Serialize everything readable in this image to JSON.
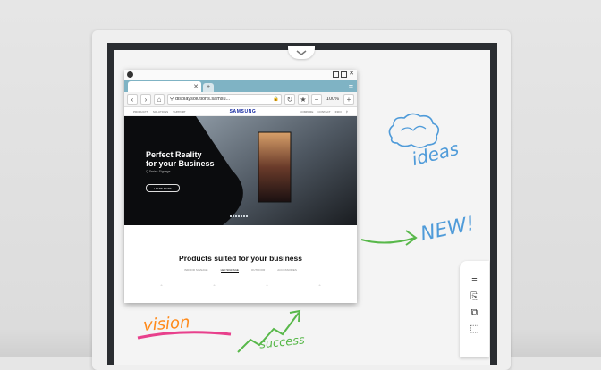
{
  "browser": {
    "url": "displaysolutions.samsu...",
    "zoom": "100%",
    "site_logo": "SAMSUNG",
    "nav_left": [
      "PRODUCTS",
      "SOLUTIONS",
      "SUPPORT"
    ],
    "nav_right": [
      "COMPARE",
      "CONTACT",
      "INFO"
    ],
    "hero_title_line1": "Perfect Reality",
    "hero_title_line2": "for your Business",
    "hero_subtitle": "Q Series Signage",
    "hero_button": "LEARN MORE",
    "products_title": "Products suited for your business",
    "product_tabs": [
      "INDOOR SIGNAGE",
      "LED SIGNAGE",
      "OUTDOOR",
      "ACCESSORIES"
    ]
  },
  "annotations": {
    "ideas": "ideas",
    "new": "NEW!",
    "vision": "vision",
    "success": "success"
  },
  "colors": {
    "annotation_blue": "#4f9bd9",
    "annotation_green": "#58b84a",
    "annotation_pink": "#e8408c",
    "annotation_orange": "#ff8a1a",
    "tab_accent": "#7fb3c4"
  },
  "icons": {
    "side_panel": [
      "menu-icon",
      "note-icon",
      "copy-icon",
      "select-icon"
    ]
  }
}
